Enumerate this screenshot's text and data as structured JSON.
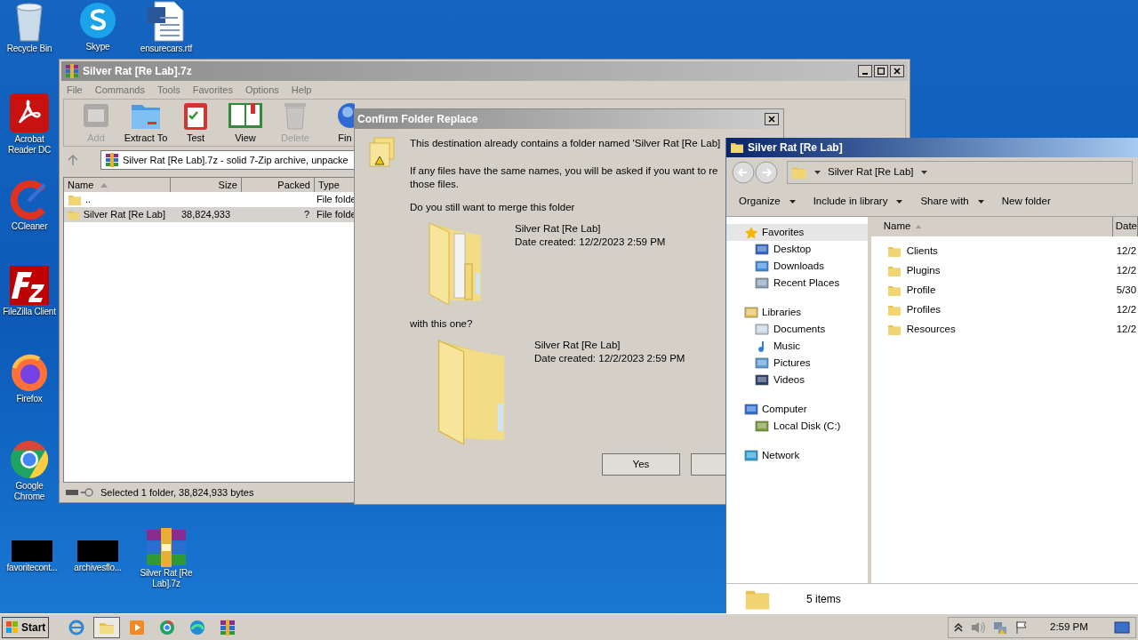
{
  "desktop_icons": [
    {
      "label": "Recycle Bin",
      "kind": "bin"
    },
    {
      "label": "Skype",
      "kind": "skype"
    },
    {
      "label": "ensurecars.rtf",
      "kind": "doc"
    },
    {
      "label": "Acrobat Reader DC",
      "kind": "acrobat"
    },
    {
      "label": "CCleaner",
      "kind": "ccleaner"
    },
    {
      "label": "FileZilla Client",
      "kind": "filezilla"
    },
    {
      "label": "Firefox",
      "kind": "firefox"
    },
    {
      "label": "Google Chrome",
      "kind": "chrome"
    },
    {
      "label": "favoritecont...",
      "kind": "black"
    },
    {
      "label": "archivesflo...",
      "kind": "black"
    },
    {
      "label": "Silver Rat [Re Lab].7z",
      "kind": "winrar"
    }
  ],
  "archive_window": {
    "title": "Silver Rat [Re Lab].7z",
    "menu": [
      "File",
      "Commands",
      "Tools",
      "Favorites",
      "Options",
      "Help"
    ],
    "toolbar": [
      {
        "label": "Add",
        "kind": "add",
        "disabled": true
      },
      {
        "label": "Extract To",
        "kind": "extract",
        "disabled": false
      },
      {
        "label": "Test",
        "kind": "test",
        "disabled": false
      },
      {
        "label": "View",
        "kind": "view",
        "disabled": false
      },
      {
        "label": "Delete",
        "kind": "delete",
        "disabled": true
      },
      {
        "label": "Fin",
        "kind": "find",
        "disabled": false
      }
    ],
    "address": "Silver Rat [Re Lab].7z - solid 7-Zip archive, unpacke",
    "columns": [
      "Name",
      "Size",
      "Packed",
      "Type"
    ],
    "rows": [
      {
        "name": "..",
        "type": "File folde",
        "selected": false
      },
      {
        "name": "Silver Rat [Re Lab]",
        "size": "38,824,933",
        "packed": "?",
        "type": "File folde",
        "selected": true
      }
    ],
    "status": "Selected 1 folder, 38,824,933 bytes"
  },
  "dialog": {
    "title": "Confirm Folder Replace",
    "message": "This destination already contains a folder named 'Silver Rat [Re Lab]",
    "detail_lines": [
      "If any files have the same names, you will be asked if you want to re",
      "those files."
    ],
    "question": "Do you still want to merge this folder",
    "existing": {
      "name": "Silver Rat [Re Lab]",
      "date": "Date created: 12/2/2023 2:59 PM"
    },
    "connector": "with this one?",
    "incoming": {
      "name": "Silver Rat [Re Lab]",
      "date": "Date created: 12/2/2023 2:59 PM"
    },
    "buttons": [
      "Yes"
    ]
  },
  "explorer": {
    "title": "Silver Rat [Re Lab]",
    "breadcrumb": "Silver Rat [Re Lab]",
    "toolbar": [
      {
        "label": "Organize",
        "dropdown": true
      },
      {
        "label": "Include in library",
        "dropdown": true
      },
      {
        "label": "Share with",
        "dropdown": true
      },
      {
        "label": "New folder",
        "dropdown": false
      }
    ],
    "nav": [
      {
        "label": "Favorites",
        "kind": "star",
        "selected": true,
        "children": [
          {
            "label": "Desktop",
            "kind": "desktop",
            "selected": false
          },
          {
            "label": "Downloads",
            "kind": "downloads",
            "selected": false
          },
          {
            "label": "Recent Places",
            "kind": "recent",
            "selected": false
          }
        ]
      },
      {
        "label": "Libraries",
        "kind": "libraries",
        "selected": false,
        "children": [
          {
            "label": "Documents",
            "kind": "documents",
            "selected": false
          },
          {
            "label": "Music",
            "kind": "music",
            "selected": false
          },
          {
            "label": "Pictures",
            "kind": "pictures",
            "selected": false
          },
          {
            "label": "Videos",
            "kind": "videos",
            "selected": false
          }
        ]
      },
      {
        "label": "Computer",
        "kind": "computer",
        "selected": false,
        "children": [
          {
            "label": "Local Disk (C:)",
            "kind": "disk",
            "selected": false
          }
        ]
      },
      {
        "label": "Network",
        "kind": "network",
        "selected": false
      }
    ],
    "columns": [
      "Name",
      "Date"
    ],
    "rows": [
      {
        "name": "Clients",
        "date": "12/2"
      },
      {
        "name": "Plugins",
        "date": "12/2"
      },
      {
        "name": "Profile",
        "date": "5/30"
      },
      {
        "name": "Profiles",
        "date": "12/2"
      },
      {
        "name": "Resources",
        "date": "12/2"
      }
    ],
    "status": "5 items"
  },
  "taskbar": {
    "start": "Start",
    "apps": [
      {
        "kind": "ie",
        "active": false
      },
      {
        "kind": "explorer",
        "active": true
      },
      {
        "kind": "media",
        "active": false
      },
      {
        "kind": "chrome",
        "active": false
      },
      {
        "kind": "edge",
        "active": false
      },
      {
        "kind": "winrar",
        "active": false
      }
    ],
    "clock": "2:59 PM"
  }
}
